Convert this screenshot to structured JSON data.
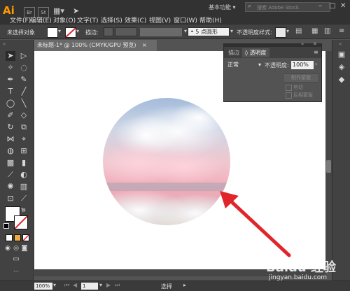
{
  "app": {
    "logo": "Ai",
    "mini_apps": [
      "Br",
      "St"
    ],
    "workspace": "基本功能",
    "search_placeholder": "搜索 Adobe Stock",
    "window_controls": [
      "–",
      "□",
      "✕"
    ]
  },
  "menu": {
    "items": [
      "文件(F)",
      "编辑(E)",
      "对象(O)",
      "文字(T)",
      "选择(S)",
      "效果(C)",
      "视图(V)",
      "窗口(W)",
      "帮助(H)"
    ]
  },
  "controlbar": {
    "selection_label": "未选择对象",
    "stroke_label": "描边:",
    "stroke_profile_marker": "•",
    "brush_value": "5 点圆形",
    "opacity_label": "不透明度",
    "style_label": "样式:"
  },
  "document": {
    "tab_title": "未标题-1* @ 100% (CMYK/GPU 预览)",
    "tab_close": "×"
  },
  "panel": {
    "tabs": [
      "描边",
      "◊ 透明度"
    ],
    "active_tab_index": 1,
    "blend_mode": "正常",
    "opacity_label": "不透明度:",
    "opacity_value": "100%",
    "make_mask_button": "制作蒙版",
    "clip_label": "剪切",
    "invert_mask_label": "反相蒙版"
  },
  "status": {
    "zoom": "100%",
    "page": "1",
    "mode": "选择"
  },
  "watermark": {
    "text": "Baidu 经验",
    "sub": "jingyan.baidu.com"
  },
  "colors": {
    "arrow": "#e0262a",
    "accent": "#ff9a00"
  }
}
